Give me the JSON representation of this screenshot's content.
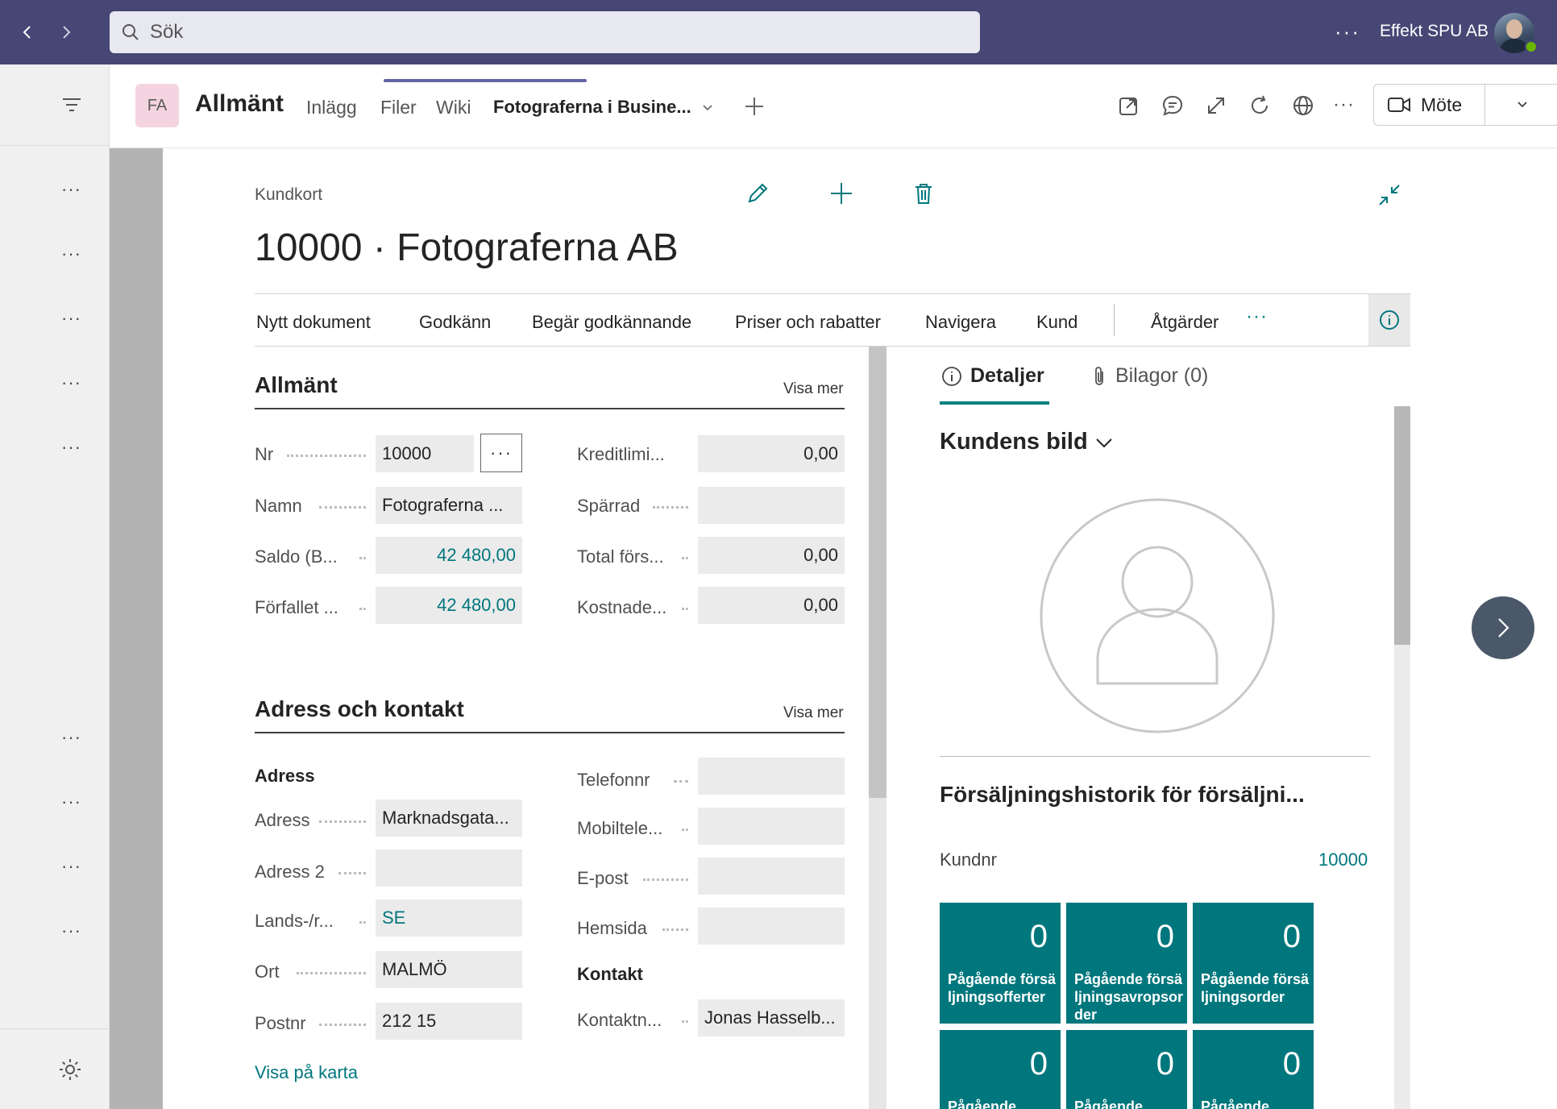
{
  "topbar": {
    "search_placeholder": "Sök",
    "more": "···",
    "org_name": "Effekt SPU AB"
  },
  "channel": {
    "avatar_initials": "FA",
    "title": "Allmänt",
    "tabs": [
      "Inlägg",
      "Filer",
      "Wiki",
      "Fotograferna i Busine..."
    ],
    "meeting_label": "Möte",
    "more": "···"
  },
  "leftrail": {
    "more": "···"
  },
  "page": {
    "breadcrumb": "Kundkort",
    "title": "10000 · Fotograferna AB"
  },
  "actions": [
    "Nytt dokument",
    "Godkänn",
    "Begär godkännande",
    "Priser och rabatter",
    "Navigera",
    "Kund",
    "Åtgärder"
  ],
  "actions_more": "···",
  "general": {
    "title": "Allmänt",
    "show_more": "Visa mer",
    "lookup": "···",
    "left_fields": [
      {
        "label": "Nr",
        "value": "10000"
      },
      {
        "label": "Namn",
        "value": "Fotograferna ..."
      },
      {
        "label": "Saldo (B...",
        "value": "42 480,00"
      },
      {
        "label": "Förfallet ...",
        "value": "42 480,00"
      }
    ],
    "right_fields": [
      {
        "label": "Kreditlimi...",
        "value": "0,00"
      },
      {
        "label": "Spärrad",
        "value": ""
      },
      {
        "label": "Total förs...",
        "value": "0,00"
      },
      {
        "label": "Kostnade...",
        "value": "0,00"
      }
    ]
  },
  "address": {
    "title": "Adress och kontakt",
    "show_more": "Visa mer",
    "address_heading": "Adress",
    "left_fields": [
      {
        "label": "Adress",
        "value": "Marknadsgata..."
      },
      {
        "label": "Adress 2",
        "value": ""
      },
      {
        "label": "Lands-/r...",
        "value": "SE"
      },
      {
        "label": "Ort",
        "value": "MALMÖ"
      },
      {
        "label": "Postnr",
        "value": "212 15"
      }
    ],
    "right_fields": [
      {
        "label": "Telefonnr",
        "value": ""
      },
      {
        "label": "Mobiltele...",
        "value": ""
      },
      {
        "label": "E-post",
        "value": ""
      },
      {
        "label": "Hemsida",
        "value": ""
      }
    ],
    "contact_heading": "Kontakt",
    "contact_field": {
      "label": "Kontaktn...",
      "value": "Jonas Hasselb..."
    },
    "map_link": "Visa på karta"
  },
  "factbox": {
    "tab_details": "Detaljer",
    "tab_attachments": "Bilagor (0)",
    "picture_title": "Kundens bild",
    "history_title": "Försäljningshistorik för försäljni...",
    "customer_no_label": "Kundnr",
    "customer_no_value": "10000",
    "tiles": [
      {
        "value": "0",
        "label": "Pågående försäljningsofferter"
      },
      {
        "value": "0",
        "label": "Pågående försäljningsavropsorder"
      },
      {
        "value": "0",
        "label": "Pågående försäljningsorder"
      },
      {
        "value": "0",
        "label": "Pågående"
      },
      {
        "value": "0",
        "label": "Pågående"
      },
      {
        "value": "0",
        "label": "Pågående"
      }
    ]
  },
  "colors": {
    "teams_purple": "#464775",
    "accent_purple": "#6264a7",
    "bc_teal": "#00777d"
  }
}
